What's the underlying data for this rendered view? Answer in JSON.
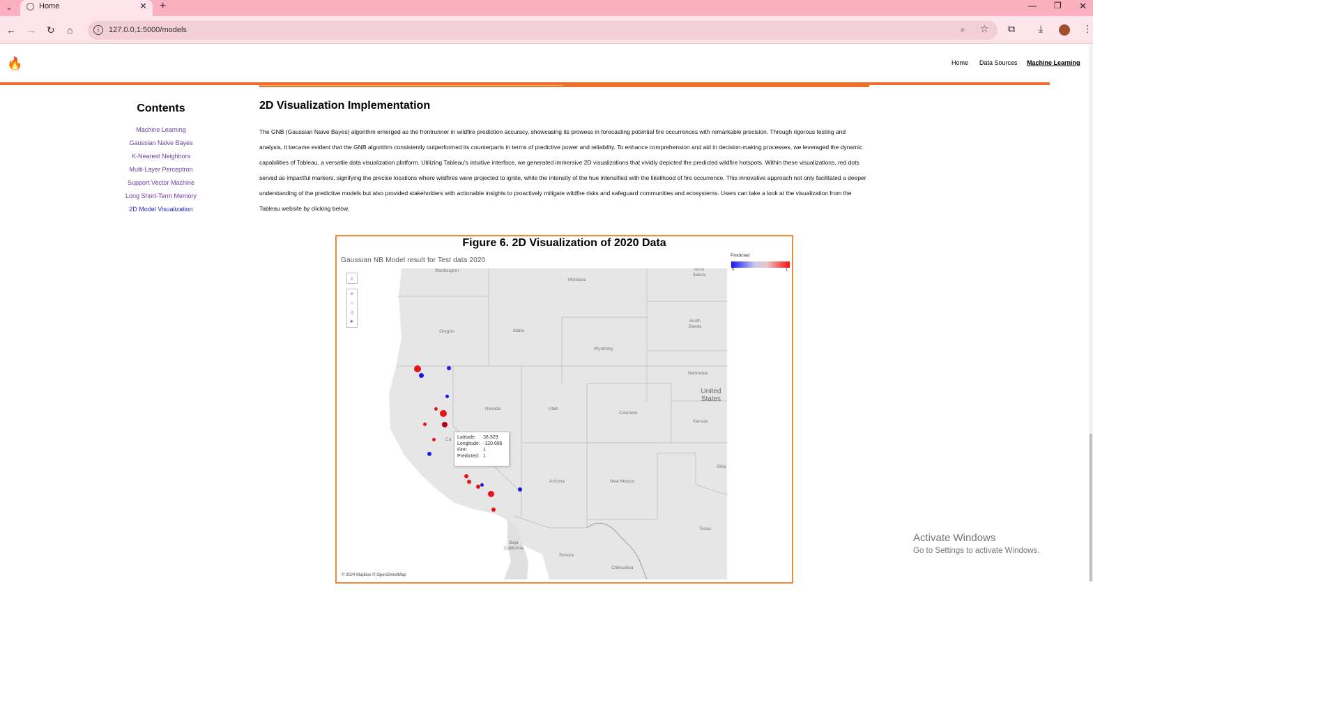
{
  "browser": {
    "tab_title": "Home",
    "url": "127.0.0.1:5000/models"
  },
  "site": {
    "nav": [
      "Home",
      "Data Sources",
      "Machine Learning"
    ],
    "active_nav": "Machine Learning",
    "brand_color": "#ee6f2a"
  },
  "sidebar": {
    "title": "Contents",
    "items": [
      "Machine Learning",
      "Gaussian Naive Bayes",
      "K-Nearest Neighbors",
      "Multi-Layer Perceptron",
      "Support Vector Machine",
      "Long Short-Term Memory",
      "2D Model Visualization"
    ]
  },
  "main": {
    "section_title": "2D Visualization Implementation",
    "paragraph": "The GNB (Gaussian Naive Bayes) algorithm emerged as the frontrunner in wildfire prediction accuracy, showcasing its prowess in forecasting potential fire occurrences with remarkable precision. Through rigorous testing and analysis, it became evident that the GNB algorithm consistently outperformed its counterparts in terms of predictive power and reliability. To enhance comprehension and aid in decision-making processes, we leveraged the dynamic capabilities of Tableau, a versatile data visualization platform. Utilizing Tableau's intuitive interface, we generated immersive 2D visualizations that vividly depicted the predicted wildfire hotspots. Within these visualizations, red dots served as impactful markers, signifying the precise locations where wildfires were projected to ignite, while the intensity of the hue intensified with the likelihood of fire occurrence. This innovative approach not only facilitated a deeper understanding of the predictive models but also provided stakeholders with actionable insights to proactively mitigate wildfire risks and safeguard communities and ecosystems. Users can take a look at the visualization from the Tableau website by clicking below."
  },
  "figure": {
    "title": "Figure 6. 2D Visualization of 2020 Data",
    "subtitle": "Gaussian NB Model result for Test data 2020",
    "legend_title": "Predicted",
    "legend_min": "0",
    "legend_max": "1",
    "attribution": "© 2024 Mapbox  © OpenStreetMap",
    "map_labels": [
      "Washington",
      "Montana",
      "North Dakota",
      "Oregon",
      "Idaho",
      "South Dakota",
      "Wyoming",
      "Nebraska",
      "United States",
      "Nevada",
      "Utah",
      "Colorado",
      "Kansas",
      "Ca",
      "Arizona",
      "New Mexico",
      "Okla",
      "Texas",
      "Baja California",
      "Sonora",
      "Chihuahua"
    ],
    "tooltip": {
      "latitude_label": "Latitude:",
      "latitude": "38.329",
      "longitude_label": "Longitude:",
      "longitude": "-120.686",
      "fire_label": "Fire:",
      "fire": "1",
      "predicted_label": "Predicted:",
      "predicted": "1"
    },
    "colors": {
      "fire": "#e8141c",
      "no_fire": "#1a1ae6",
      "selected": "#b00010"
    }
  },
  "watermark": {
    "line1": "Activate Windows",
    "line2": "Go to Settings to activate Windows."
  }
}
